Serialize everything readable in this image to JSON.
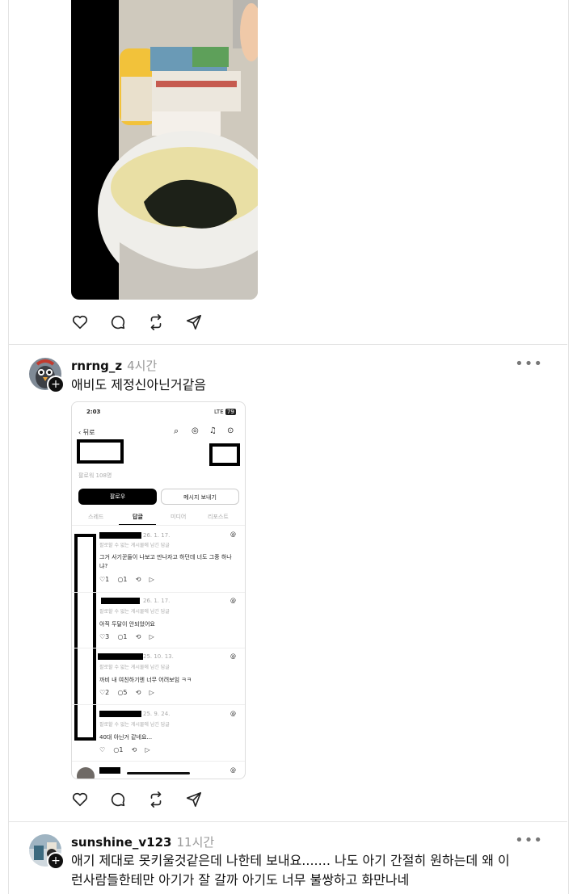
{
  "post2": {
    "username": "rnrng_z",
    "time": "4시간",
    "text": "애비도 제정신아닌거같음",
    "shot": {
      "clock": "2:03",
      "signal": "LTE",
      "battery": "79",
      "back": "뒤로",
      "followers": "팔로워 108명",
      "follow_btn": "팔로우",
      "message_btn": "메시지 보내기",
      "tabs": [
        "스레드",
        "답글",
        "미디어",
        "리포스트"
      ],
      "replies": [
        {
          "date": "26. 1. 17.",
          "sub": "팔로할 수 없는 게시물에 남긴 답글",
          "text": "그거 사기꾼들이 나보고 만나자고 하던데 너도 그중 하나냐?",
          "likes": "1",
          "comments": "1"
        },
        {
          "date": "26. 1. 17.",
          "sub": "팔로할 수 없는 게시물에 남긴 답글",
          "text": "아직 두달이 안되었어요",
          "likes": "3",
          "comments": "1"
        },
        {
          "date": "25. 10. 13.",
          "sub": "팔로할 수 없는 게시물에 남긴 답글",
          "text": "까비 내 여친하기엔 너무 어려보임 ㅋㅋ",
          "likes": "2",
          "comments": "5"
        },
        {
          "date": "25. 9. 24.",
          "sub": "팔로할 수 없는 게시물에 남긴 답글",
          "text": "40대 아닌거 같네요...",
          "likes": "",
          "comments": "1"
        }
      ]
    }
  },
  "post3": {
    "username": "sunshine_v123",
    "time": "11시간",
    "text_line1": "애기 제대로 못키울것같은데 나한테 보내요....... 나도 아기 간절히 원하는데 왜 이",
    "text_line2": "런사람들한테만 아기가 잘 갈까 아기도 너무 불쌍하고 화만나네"
  },
  "icons": [
    "heart-icon",
    "comment-icon",
    "repost-icon",
    "share-icon",
    "more-icon"
  ]
}
